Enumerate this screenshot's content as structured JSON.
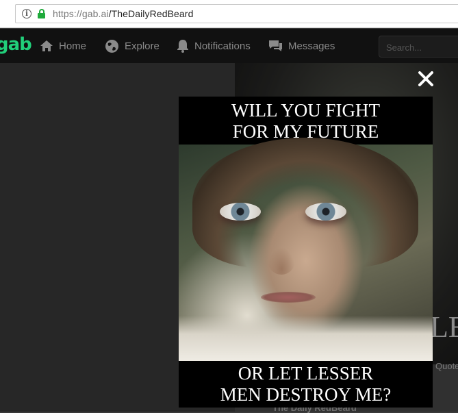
{
  "browser": {
    "url_host": "https://gab.ai",
    "url_path": "/TheDailyRedBeard"
  },
  "nav": {
    "logo": "gab",
    "items": [
      {
        "label": "Home",
        "icon": "home-icon"
      },
      {
        "label": "Explore",
        "icon": "globe-icon"
      },
      {
        "label": "Notifications",
        "icon": "bell-icon"
      },
      {
        "label": "Messages",
        "icon": "chat-icon"
      }
    ],
    "search_placeholder": "Search..."
  },
  "background_post": {
    "meme_fragment": "LE",
    "quote_label": "Quote",
    "author": "The Daily RedBeard"
  },
  "modal": {
    "close_icon": "close-icon",
    "meme_top_line1": "WILL YOU FIGHT",
    "meme_top_line2": "FOR MY FUTURE",
    "meme_bottom_line1": "OR LET LESSER",
    "meme_bottom_line2": "MEN DESTROY ME?"
  },
  "colors": {
    "brand_green": "#21cf7a",
    "lock_green": "#1faa3b",
    "nav_bg": "#111111"
  }
}
